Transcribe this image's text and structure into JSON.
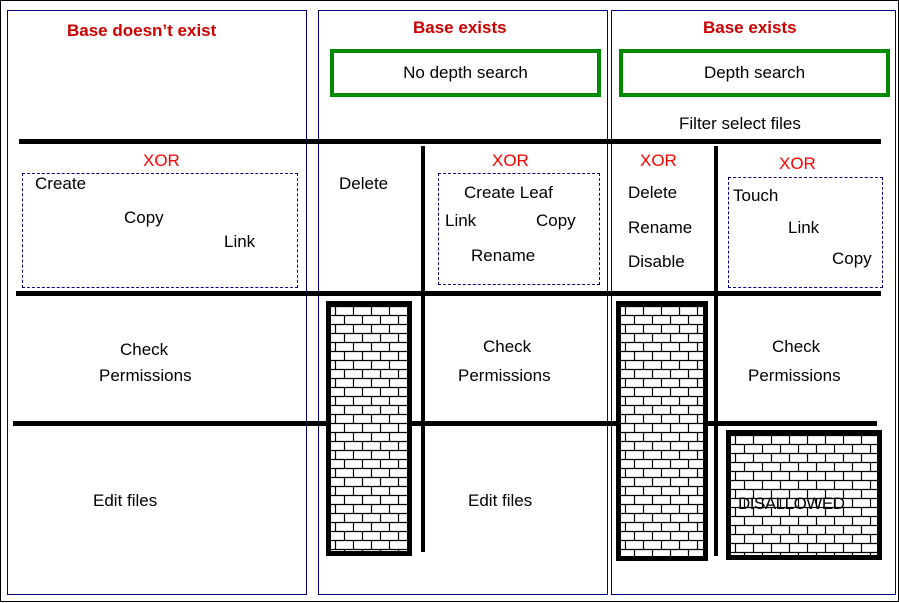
{
  "colors": {
    "heading": "#cc0000",
    "xor": "#ff0000",
    "column_border": "#000080",
    "search_box_border": "#008a00",
    "line": "#000000"
  },
  "columns": [
    {
      "heading": "Base doesn’t exist",
      "xor_label": "XOR",
      "operations": [
        "Create",
        "Copy",
        "Link"
      ],
      "check": [
        "Check",
        "Permissions"
      ],
      "edit": "Edit files"
    },
    {
      "heading": "Base exists",
      "search_mode": "No depth search",
      "standalone_op": "Delete",
      "xor_label": "XOR",
      "operations": [
        "Create Leaf",
        "Link",
        "Copy",
        "Rename"
      ],
      "check": [
        "Check",
        "Permissions"
      ],
      "edit": "Edit files"
    },
    {
      "heading": "Base exists",
      "search_mode": "Depth search",
      "filter": "Filter select files",
      "left_xor_label": "XOR",
      "left_operations": [
        "Delete",
        "Rename",
        "Disable"
      ],
      "right_xor_label": "XOR",
      "right_operations": [
        "Touch",
        "Link",
        "Copy"
      ],
      "check": [
        "Check",
        "Permissions"
      ],
      "blocked_label": "DISALLOWED"
    }
  ]
}
